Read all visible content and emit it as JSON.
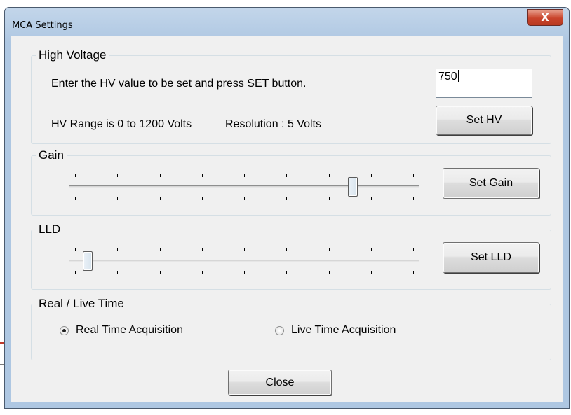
{
  "window": {
    "title": "MCA Settings",
    "close_glyph": "X"
  },
  "high_voltage": {
    "group_label": "High Voltage",
    "instruction": "Enter the HV value to be set and press SET button.",
    "range_text": "HV Range is 0 to 1200 Volts",
    "resolution_text": "Resolution : 5 Volts",
    "value": "750",
    "button_label": "Set HV"
  },
  "gain": {
    "group_label": "Gain",
    "button_label": "Set Gain",
    "slider_position_fraction": 0.82,
    "tick_count": 9
  },
  "lld": {
    "group_label": "LLD",
    "button_label": "Set LLD",
    "slider_position_fraction": 0.04,
    "tick_count": 9
  },
  "real_live_time": {
    "group_label": "Real / Live Time",
    "options": [
      {
        "label": "Real Time Acquisition",
        "selected": true
      },
      {
        "label": "Live Time Acquisition",
        "selected": false
      }
    ]
  },
  "footer": {
    "close_label": "Close"
  },
  "colors": {
    "title_bar": "#aec7e2",
    "client_bg": "#f0f0f0",
    "close_button": "#c9442b"
  }
}
